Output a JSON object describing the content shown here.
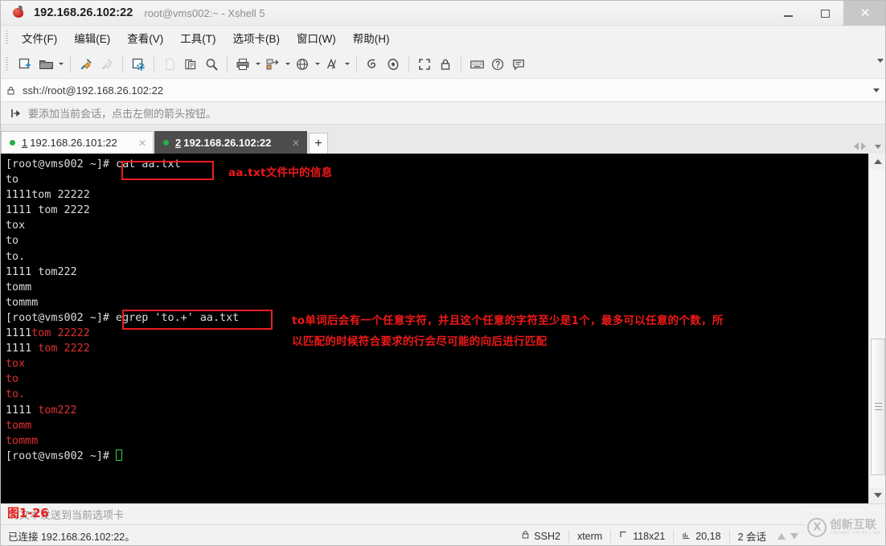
{
  "window": {
    "host": "192.168.26.102:22",
    "subtitle": "root@vms002:~ - Xshell 5",
    "minimize_label": "–",
    "maximize_label": "□",
    "close_label": "✕"
  },
  "menubar": {
    "items": [
      {
        "label": "文件(F)",
        "name": "menu-file"
      },
      {
        "label": "编辑(E)",
        "name": "menu-edit"
      },
      {
        "label": "查看(V)",
        "name": "menu-view"
      },
      {
        "label": "工具(T)",
        "name": "menu-tools"
      },
      {
        "label": "选项卡(B)",
        "name": "menu-tabs"
      },
      {
        "label": "窗口(W)",
        "name": "menu-window"
      },
      {
        "label": "帮助(H)",
        "name": "menu-help"
      }
    ]
  },
  "toolbar": {
    "icons": [
      "new-session-icon",
      "open-folder-icon",
      "reconnect-icon",
      "disconnect-icon",
      "session-properties-icon",
      "copy-page-icon",
      "paste-icon",
      "find-icon",
      "print-icon",
      "transfer-icon",
      "globe-icon",
      "font-icon",
      "ssh-tunnel-icon",
      "sftp-icon",
      "fullscreen-icon",
      "lock-icon",
      "keyboard-icon",
      "help-icon",
      "feedback-icon"
    ],
    "overflow_label": "toolbar-overflow"
  },
  "addressbar": {
    "lock_icon": "lock-icon",
    "url": "ssh://root@192.168.26.102:22"
  },
  "hintbar": {
    "icon": "add-session-icon",
    "text": "要添加当前会话，点击左侧的箭头按钮。"
  },
  "tabs": {
    "items": [
      {
        "num": "1",
        "label": "192.168.26.101:22",
        "active": false,
        "close_label": "✕"
      },
      {
        "num": "2",
        "label": "192.168.26.102:22",
        "active": true,
        "close_label": "✕"
      }
    ],
    "add_label": "+"
  },
  "terminal": {
    "cols": "118",
    "rows": "21",
    "lines": [
      {
        "segs": [
          {
            "t": "[root@vms002 ~]# cat aa.txt",
            "c": "w"
          }
        ]
      },
      {
        "segs": [
          {
            "t": "to",
            "c": "w"
          }
        ]
      },
      {
        "segs": [
          {
            "t": "1111tom 22222",
            "c": "w"
          }
        ]
      },
      {
        "segs": [
          {
            "t": "1111 tom 2222",
            "c": "w"
          }
        ]
      },
      {
        "segs": [
          {
            "t": "tox",
            "c": "w"
          }
        ]
      },
      {
        "segs": [
          {
            "t": "to",
            "c": "w"
          }
        ]
      },
      {
        "segs": [
          {
            "t": "to.",
            "c": "w"
          }
        ]
      },
      {
        "segs": [
          {
            "t": "1111 tom222",
            "c": "w"
          }
        ]
      },
      {
        "segs": [
          {
            "t": "tomm",
            "c": "w"
          }
        ]
      },
      {
        "segs": [
          {
            "t": "tommm",
            "c": "w"
          }
        ]
      },
      {
        "segs": [
          {
            "t": "[root@vms002 ~]# egrep 'to.+' aa.txt",
            "c": "w"
          }
        ]
      },
      {
        "segs": [
          {
            "t": "1111",
            "c": "w"
          },
          {
            "t": "tom 22222",
            "c": "r"
          }
        ]
      },
      {
        "segs": [
          {
            "t": "1111 ",
            "c": "w"
          },
          {
            "t": "tom 2222",
            "c": "r"
          }
        ]
      },
      {
        "segs": [
          {
            "t": "tox",
            "c": "r"
          }
        ]
      },
      {
        "segs": [
          {
            "t": "to",
            "c": "r"
          }
        ]
      },
      {
        "segs": [
          {
            "t": "to.",
            "c": "r"
          }
        ]
      },
      {
        "segs": [
          {
            "t": "1111 ",
            "c": "w"
          },
          {
            "t": "tom222",
            "c": "r"
          }
        ]
      },
      {
        "segs": [
          {
            "t": "tomm",
            "c": "r"
          }
        ]
      },
      {
        "segs": [
          {
            "t": "tommm",
            "c": "r"
          }
        ]
      },
      {
        "segs": [
          {
            "t": "[root@vms002 ~]# ",
            "c": "w"
          },
          {
            "t": "",
            "c": "cursor"
          }
        ]
      }
    ]
  },
  "annotations": {
    "box_cat_cmd": "cat aa.txt",
    "box_egrep_cmd": "egrep 'to.+' aa.txt",
    "note_top": "aa.txt文件中的信息",
    "note_mid_line1": "to单词后会有一个任意字符，并且这个任意的字符至少是1个，最多可以任意的个数，所",
    "note_mid_line2": "以匹配的时候符合要求的行会尽可能的向后进行匹配",
    "figure_label": "图1-26",
    "accent_color": "#ee1c1c"
  },
  "sendbar": {
    "text": "将文本发送到当前选项卡"
  },
  "statusbar": {
    "connection": "已连接 192.168.26.102:22。",
    "protocol": "SSH2",
    "terminal_type": "xterm",
    "size": "118x21",
    "cursor_pos": "20,18",
    "sessions": "2 会话",
    "lock_icon": "lock-icon",
    "size_icon": "resize-icon",
    "pos_icon": "cursor-pos-icon"
  },
  "watermark": {
    "cn": "创新互联",
    "en": "CHUANG XIN HU LIAN"
  }
}
